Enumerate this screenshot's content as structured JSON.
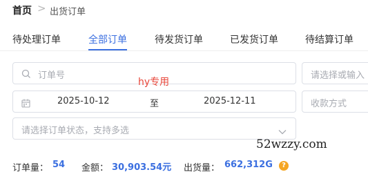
{
  "breadcrumb": {
    "home": "首页",
    "separator": ">",
    "current": "出货订单"
  },
  "tabs": [
    {
      "label": "待处理订单"
    },
    {
      "label": "全部订单"
    },
    {
      "label": "待发货订单"
    },
    {
      "label": "已发货订单"
    },
    {
      "label": "待结算订单"
    }
  ],
  "filters": {
    "order_no_placeholder": "订单号",
    "right_select_placeholder": "请选择或输入",
    "date_start": "2025-10-12",
    "date_separator": "至",
    "date_end": "2025-12-11",
    "pay_method_placeholder": "收款方式",
    "status_placeholder": "请选择订单状态，支持多选"
  },
  "watermarks": {
    "hy": "hy专用",
    "site": "52wzzy.com"
  },
  "summary": {
    "order_count_label": "订单量：",
    "order_count": "54",
    "amount_label": "金额：",
    "amount": "30,903.54元",
    "shipment_label": "出货量：",
    "shipment": "662,312G",
    "help": "?"
  },
  "colors": {
    "accent": "#3b6fe0",
    "help_icon": "#f5a623",
    "watermark": "#e8473b"
  }
}
